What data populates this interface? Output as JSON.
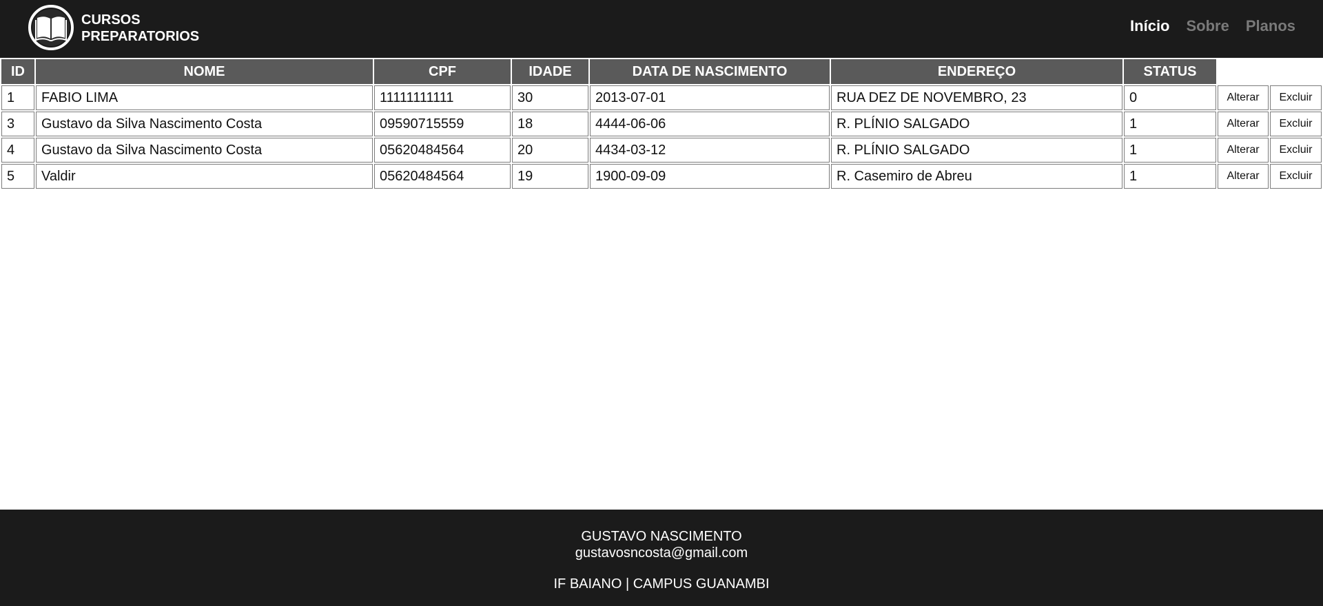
{
  "header": {
    "brand_line1": "CURSOS",
    "brand_line2": "PREPARATORIOS",
    "nav": [
      "Início",
      "Sobre",
      "Planos"
    ]
  },
  "table": {
    "columns": [
      "ID",
      "NOME",
      "CPF",
      "IDADE",
      "DATA DE NASCIMENTO",
      "ENDEREÇO",
      "STATUS"
    ],
    "rows": [
      {
        "id": "1",
        "nome": "FABIO LIMA",
        "cpf": "11111111111",
        "idade": "30",
        "nascimento": "2013-07-01",
        "endereco": "RUA DEZ DE NOVEMBRO, 23",
        "status": "0"
      },
      {
        "id": "3",
        "nome": "Gustavo da Silva Nascimento Costa",
        "cpf": "09590715559",
        "idade": "18",
        "nascimento": "4444-06-06",
        "endereco": "R. PLÍNIO SALGADO",
        "status": "1"
      },
      {
        "id": "4",
        "nome": "Gustavo da Silva Nascimento Costa",
        "cpf": "05620484564",
        "idade": "20",
        "nascimento": "4434-03-12",
        "endereco": "R. PLÍNIO SALGADO",
        "status": "1"
      },
      {
        "id": "5",
        "nome": "Valdir",
        "cpf": "05620484564",
        "idade": "19",
        "nascimento": "1900-09-09",
        "endereco": "R. Casemiro de Abreu",
        "status": "1"
      }
    ],
    "alter_label": "Alterar",
    "delete_label": "Excluir"
  },
  "footer": {
    "name": "GUSTAVO NASCIMENTO",
    "email": "gustavosncosta@gmail.com",
    "institution": "IF BAIANO | CAMPUS GUANAMBI"
  }
}
